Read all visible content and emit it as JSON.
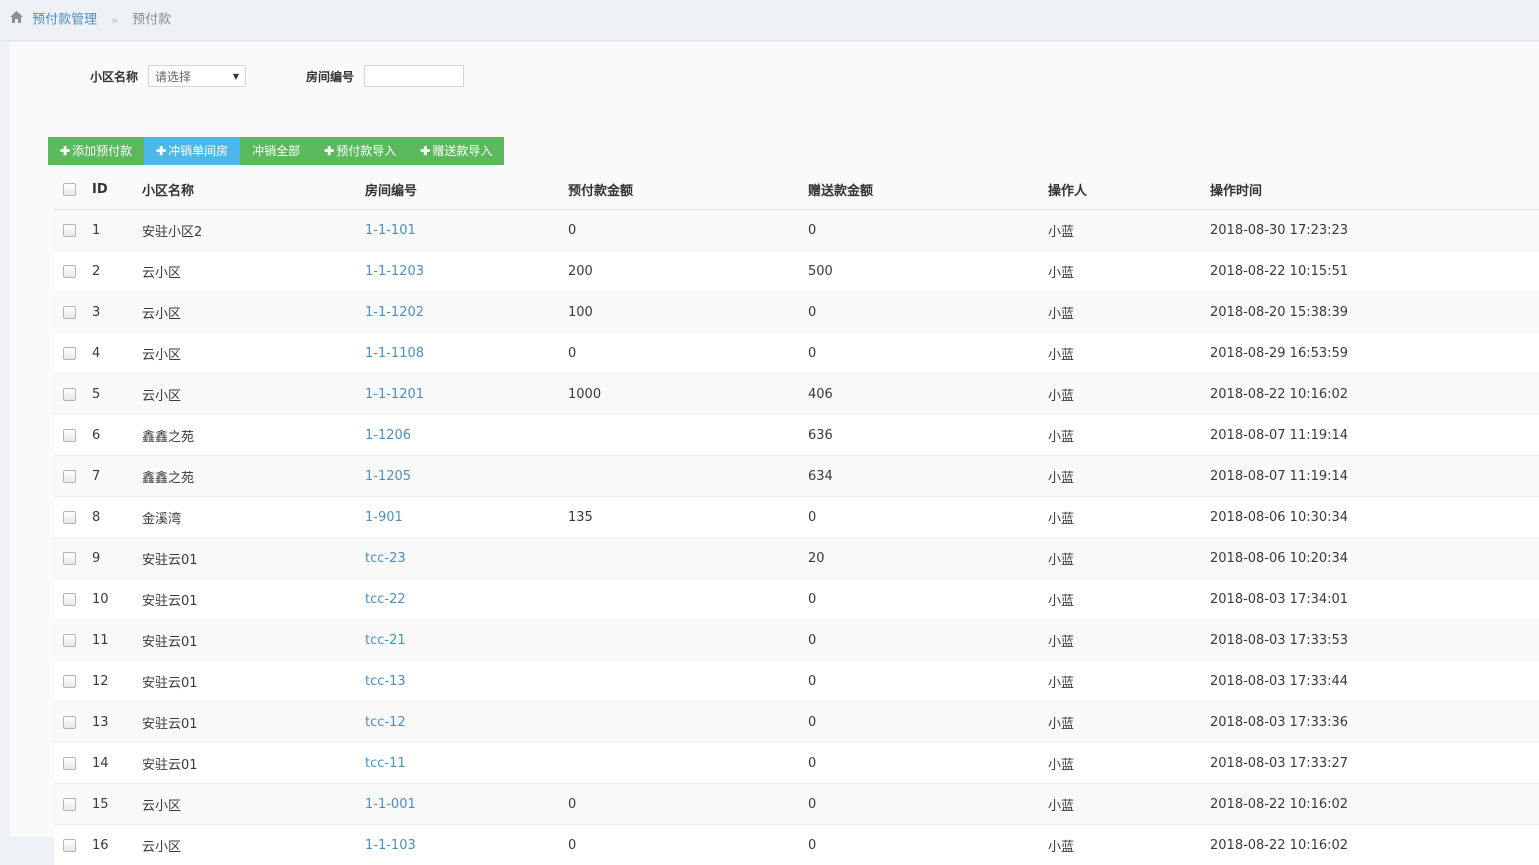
{
  "breadcrumb": {
    "root": "预付款管理",
    "separator": "»",
    "current": "预付款"
  },
  "filter": {
    "community_label": "小区名称",
    "community_value": "请选择",
    "room_label": "房间编号",
    "room_value": ""
  },
  "toolbar": {
    "add_prepay": "添加预付款",
    "cancel_single": "冲销单间房",
    "cancel_all": "冲销全部",
    "import_prepay": "预付款导入",
    "import_gift": "赠送款导入"
  },
  "table": {
    "headers": {
      "id": "ID",
      "community": "小区名称",
      "room": "房间编号",
      "prepay": "预付款金额",
      "gift": "赠送款金额",
      "operator": "操作人",
      "time": "操作时间"
    },
    "rows": [
      {
        "id": "1",
        "community": "安驻小区2",
        "room": "1-1-101",
        "prepay": "0",
        "gift": "0",
        "operator": "小蓝",
        "time": "2018-08-30 17:23:23"
      },
      {
        "id": "2",
        "community": "云小区",
        "room": "1-1-1203",
        "prepay": "200",
        "gift": "500",
        "operator": "小蓝",
        "time": "2018-08-22 10:15:51"
      },
      {
        "id": "3",
        "community": "云小区",
        "room": "1-1-1202",
        "prepay": "100",
        "gift": "0",
        "operator": "小蓝",
        "time": "2018-08-20 15:38:39"
      },
      {
        "id": "4",
        "community": "云小区",
        "room": "1-1-1108",
        "prepay": "0",
        "gift": "0",
        "operator": "小蓝",
        "time": "2018-08-29 16:53:59"
      },
      {
        "id": "5",
        "community": "云小区",
        "room": "1-1-1201",
        "prepay": "1000",
        "gift": "406",
        "operator": "小蓝",
        "time": "2018-08-22 10:16:02"
      },
      {
        "id": "6",
        "community": "鑫鑫之苑",
        "room": "1-1206",
        "prepay": "",
        "gift": "636",
        "operator": "小蓝",
        "time": "2018-08-07 11:19:14"
      },
      {
        "id": "7",
        "community": "鑫鑫之苑",
        "room": "1-1205",
        "prepay": "",
        "gift": "634",
        "operator": "小蓝",
        "time": "2018-08-07 11:19:14"
      },
      {
        "id": "8",
        "community": "金溪湾",
        "room": "1-901",
        "prepay": "135",
        "gift": "0",
        "operator": "小蓝",
        "time": "2018-08-06 10:30:34"
      },
      {
        "id": "9",
        "community": "安驻云01",
        "room": "tcc-23",
        "prepay": "",
        "gift": "20",
        "operator": "小蓝",
        "time": "2018-08-06 10:20:34"
      },
      {
        "id": "10",
        "community": "安驻云01",
        "room": "tcc-22",
        "prepay": "",
        "gift": "0",
        "operator": "小蓝",
        "time": "2018-08-03 17:34:01"
      },
      {
        "id": "11",
        "community": "安驻云01",
        "room": "tcc-21",
        "prepay": "",
        "gift": "0",
        "operator": "小蓝",
        "time": "2018-08-03 17:33:53"
      },
      {
        "id": "12",
        "community": "安驻云01",
        "room": "tcc-13",
        "prepay": "",
        "gift": "0",
        "operator": "小蓝",
        "time": "2018-08-03 17:33:44"
      },
      {
        "id": "13",
        "community": "安驻云01",
        "room": "tcc-12",
        "prepay": "",
        "gift": "0",
        "operator": "小蓝",
        "time": "2018-08-03 17:33:36"
      },
      {
        "id": "14",
        "community": "安驻云01",
        "room": "tcc-11",
        "prepay": "",
        "gift": "0",
        "operator": "小蓝",
        "time": "2018-08-03 17:33:27"
      },
      {
        "id": "15",
        "community": "云小区",
        "room": "1-1-001",
        "prepay": "0",
        "gift": "0",
        "operator": "小蓝",
        "time": "2018-08-22 10:16:02"
      },
      {
        "id": "16",
        "community": "云小区",
        "room": "1-1-103",
        "prepay": "0",
        "gift": "0",
        "operator": "小蓝",
        "time": "2018-08-22 10:16:02"
      }
    ]
  }
}
